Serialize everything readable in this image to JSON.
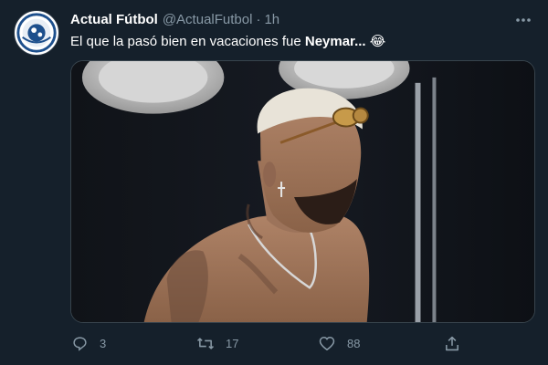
{
  "tweet": {
    "author_name": "Actual Fútbol",
    "handle": "@ActualFutbol",
    "separator": "·",
    "time": "1h",
    "text_prefix": "El que la pasó bien en vacaciones fue ",
    "text_bold": "Neymar...",
    "emoji": "😂",
    "replies": "3",
    "retweets": "17",
    "likes": "88"
  },
  "icons": {
    "more": "more-horizontal-icon",
    "reply": "reply-icon",
    "retweet": "retweet-icon",
    "like": "heart-icon",
    "share": "share-icon"
  },
  "colors": {
    "background": "#15202b",
    "secondary_text": "#8899a6",
    "border": "#38444d"
  }
}
